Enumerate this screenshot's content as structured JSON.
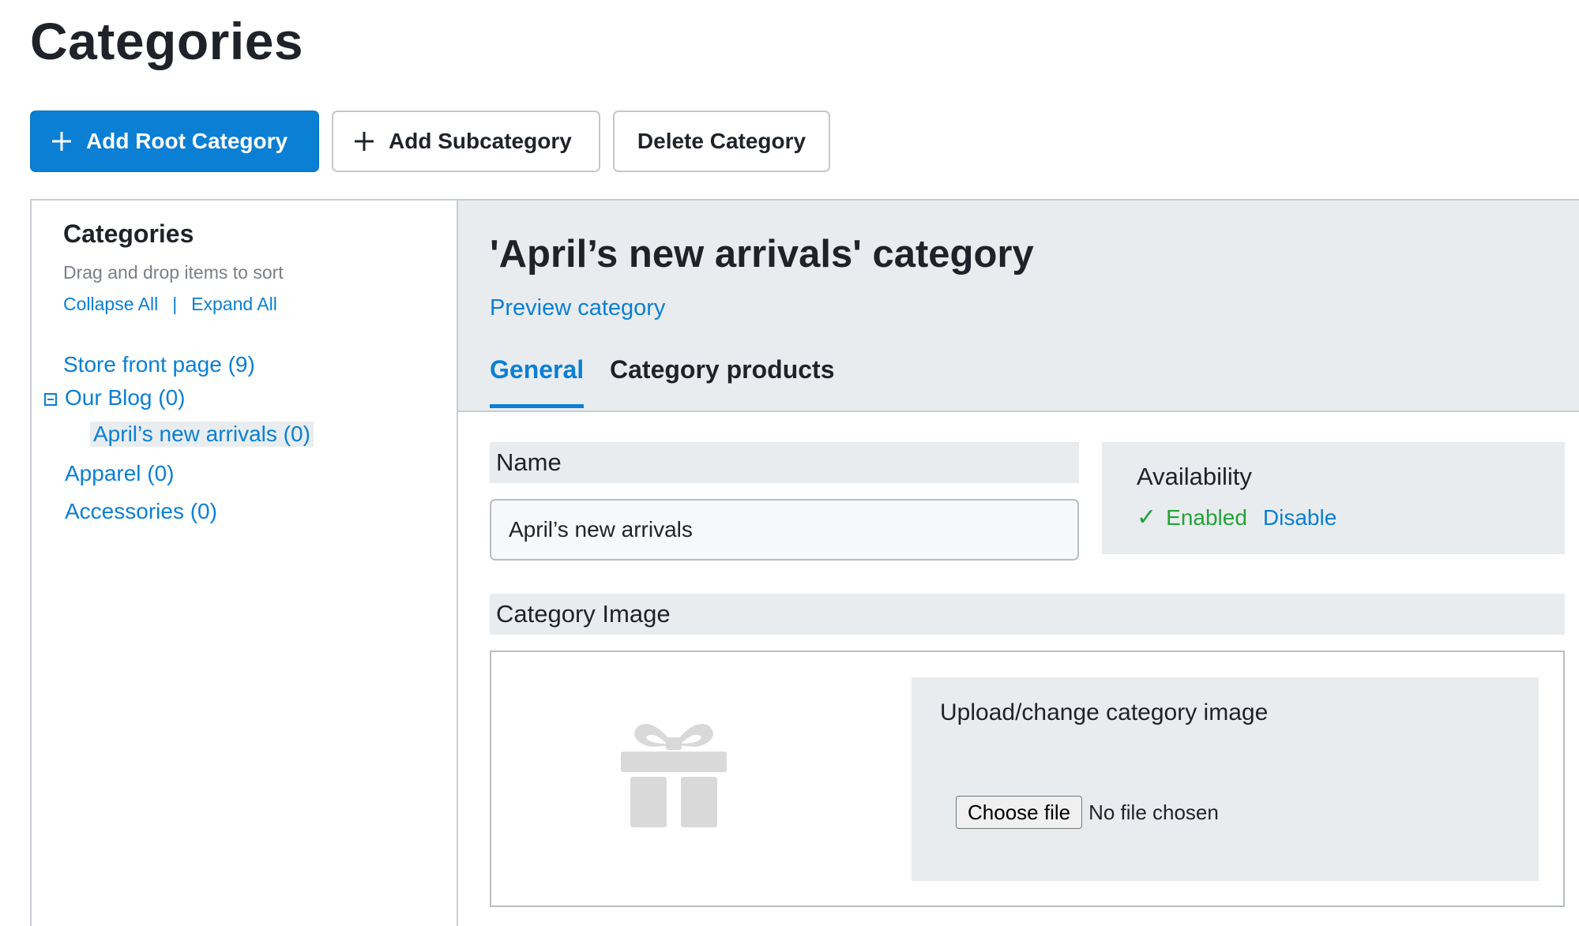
{
  "page": {
    "title": "Categories"
  },
  "toolbar": {
    "add_root_label": "Add Root Category",
    "add_sub_label": "Add Subcategory",
    "delete_label": "Delete Category"
  },
  "sidebar": {
    "title": "Categories",
    "hint": "Drag and drop items to sort",
    "collapse_all": "Collapse All",
    "separator": "|",
    "expand_all": "Expand All",
    "items": [
      {
        "label": "Store front page (9)",
        "level": 0
      },
      {
        "label": "Our Blog (0)",
        "level": 0,
        "expanded": true
      },
      {
        "label": "April’s new arrivals (0)",
        "level": 1,
        "selected": true
      },
      {
        "label": "Apparel (0)",
        "level": 0
      },
      {
        "label": "Accessories (0)",
        "level": 0
      }
    ]
  },
  "main": {
    "title": "'April’s new arrivals' category",
    "preview_link": "Preview category",
    "tabs": [
      {
        "label": "General",
        "active": true
      },
      {
        "label": "Category products",
        "active": false
      }
    ],
    "name_label": "Name",
    "name_value": "April’s new arrivals",
    "availability": {
      "title": "Availability",
      "status": "Enabled",
      "action": "Disable"
    },
    "image": {
      "label": "Category Image",
      "upload_title": "Upload/change category image",
      "choose_file": "Choose file",
      "no_file": "No file chosen"
    }
  },
  "colors": {
    "accent": "#0a7fd4",
    "success": "#21a336",
    "panel_bg": "#e9ecef"
  }
}
